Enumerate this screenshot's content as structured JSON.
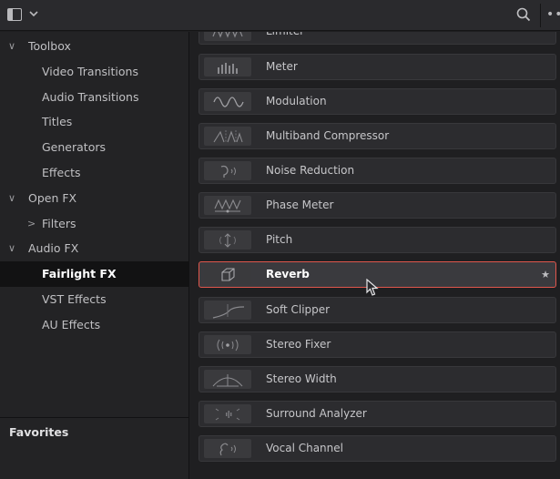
{
  "sidebar": {
    "items": [
      {
        "label": "Toolbox",
        "chevron": "down"
      },
      {
        "label": "Video Transitions"
      },
      {
        "label": "Audio Transitions"
      },
      {
        "label": "Titles"
      },
      {
        "label": "Generators"
      },
      {
        "label": "Effects"
      },
      {
        "label": "Open FX",
        "chevron": "down"
      },
      {
        "label": "Filters",
        "chevron": "right"
      },
      {
        "label": "Audio FX",
        "chevron": "down"
      },
      {
        "label": "Fairlight FX",
        "active": true
      },
      {
        "label": "VST Effects"
      },
      {
        "label": "AU Effects"
      }
    ],
    "favorites_label": "Favorites"
  },
  "effects": [
    {
      "label": "Limiter",
      "icon": "limiter-icon"
    },
    {
      "label": "Meter",
      "icon": "meter-icon"
    },
    {
      "label": "Modulation",
      "icon": "modulation-icon"
    },
    {
      "label": "Multiband Compressor",
      "icon": "multiband-compressor-icon"
    },
    {
      "label": "Noise Reduction",
      "icon": "noise-reduction-icon"
    },
    {
      "label": "Phase Meter",
      "icon": "phase-meter-icon"
    },
    {
      "label": "Pitch",
      "icon": "pitch-icon"
    },
    {
      "label": "Reverb",
      "icon": "reverb-icon",
      "selected": true,
      "favorite": true
    },
    {
      "label": "Soft Clipper",
      "icon": "soft-clipper-icon"
    },
    {
      "label": "Stereo Fixer",
      "icon": "stereo-fixer-icon"
    },
    {
      "label": "Stereo Width",
      "icon": "stereo-width-icon"
    },
    {
      "label": "Surround Analyzer",
      "icon": "surround-analyzer-icon"
    },
    {
      "label": "Vocal Channel",
      "icon": "vocal-channel-icon"
    }
  ],
  "colors": {
    "selection_border": "#e0564c",
    "active_sidebar_bg": "#121213"
  },
  "toolbar_icons": [
    "panel-toggle-icon",
    "chevron-down-icon",
    "search-icon",
    "more-options-icon"
  ]
}
